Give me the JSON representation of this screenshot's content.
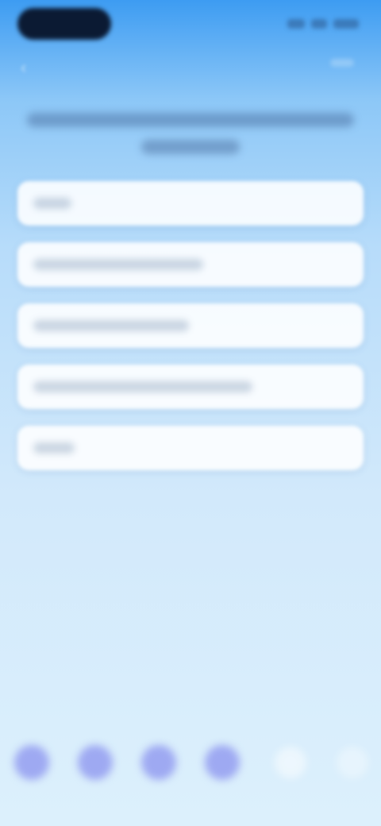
{
  "status_bar": {
    "time": ""
  },
  "header": {
    "back_icon": "chevron-left-icon"
  },
  "question": {
    "text": ""
  },
  "options": [
    {
      "label": ""
    },
    {
      "label": ""
    },
    {
      "label": ""
    },
    {
      "label": ""
    },
    {
      "label": ""
    }
  ],
  "bottom_nav": {
    "items": [
      {
        "icon": "circle-icon"
      },
      {
        "icon": "circle-icon"
      },
      {
        "icon": "circle-icon"
      },
      {
        "icon": "circle-icon"
      },
      {
        "icon": "circle-icon"
      },
      {
        "icon": "circle-icon"
      }
    ]
  },
  "colors": {
    "accent": "#9ea9f2",
    "background_top": "#3d9cf2",
    "background_bottom": "#dcf0fc"
  }
}
